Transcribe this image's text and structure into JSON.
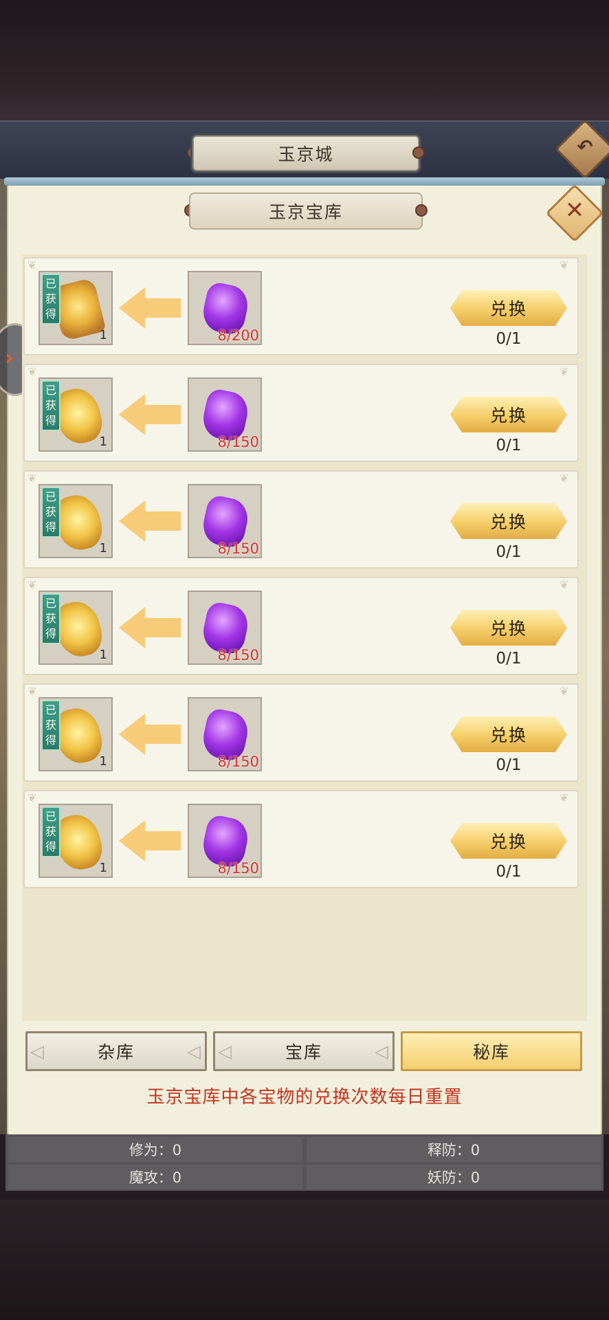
{
  "header": {
    "city_title": "玉京城"
  },
  "panel": {
    "title": "玉京宝库",
    "close_icon": "✕",
    "back_icon": "↶"
  },
  "items": [
    {
      "got_label": "已获得",
      "reward_qty": "1",
      "reward_art": "golden-book",
      "cost_count": "8/200",
      "button": "兑换",
      "count": "0/1"
    },
    {
      "got_label": "已获得",
      "reward_qty": "1",
      "reward_art": "golden-scroll",
      "cost_count": "8/150",
      "button": "兑换",
      "count": "0/1"
    },
    {
      "got_label": "已获得",
      "reward_qty": "1",
      "reward_art": "golden-scroll",
      "cost_count": "8/150",
      "button": "兑换",
      "count": "0/1"
    },
    {
      "got_label": "已获得",
      "reward_qty": "1",
      "reward_art": "golden-scroll",
      "cost_count": "8/150",
      "button": "兑换",
      "count": "0/1"
    },
    {
      "got_label": "已获得",
      "reward_qty": "1",
      "reward_art": "golden-scroll",
      "cost_count": "8/150",
      "button": "兑换",
      "count": "0/1"
    },
    {
      "got_label": "已获得",
      "reward_qty": "1",
      "reward_art": "golden-scroll",
      "cost_count": "8/150",
      "button": "兑换",
      "count": "0/1"
    }
  ],
  "tabs": [
    {
      "label": "杂库",
      "active": false
    },
    {
      "label": "宝库",
      "active": false
    },
    {
      "label": "秘库",
      "active": true
    }
  ],
  "notice": "玉京宝库中各宝物的兑换次数每日重置",
  "stats": [
    {
      "label": "修为：0"
    },
    {
      "label": "释防：0"
    },
    {
      "label": "魔攻：0"
    },
    {
      "label": "妖防：0"
    }
  ],
  "colors": {
    "cost_red": "#d3322d",
    "button_gold": "#f5cd68",
    "notice_red": "#c0351f"
  }
}
